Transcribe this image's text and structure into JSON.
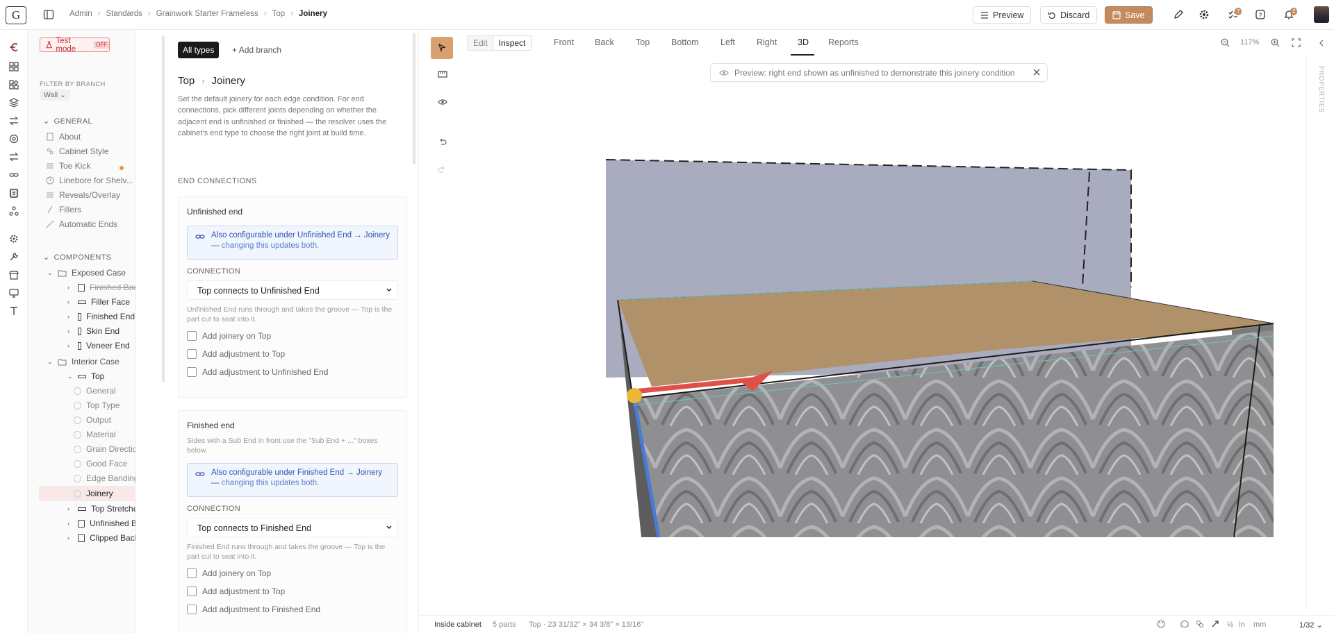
{
  "topbar": {
    "logo": "G",
    "breadcrumbs": [
      "Admin",
      "Standards",
      "Grainwork Starter Frameless",
      "Top",
      "Joinery"
    ],
    "preview_label": "Preview",
    "discard_label": "Discard",
    "save_label": "Save",
    "tasks_badge": "7",
    "notif_badge": "2"
  },
  "tree": {
    "test_mode_label": "Test mode",
    "test_mode_state": "OFF",
    "filter_label": "FILTER BY BRANCH",
    "branch_value": "Wall",
    "general_label": "GENERAL",
    "general_items": [
      "About",
      "Cabinet Style",
      "Toe Kick",
      "Linebore for Shelv...",
      "Reveals/Overlay",
      "Fillers",
      "Automatic Ends"
    ],
    "components_label": "COMPONENTS",
    "exposed_case": "Exposed Case",
    "exposed_items": [
      "Finished Back",
      "Filler Face",
      "Finished End",
      "Skin End",
      "Veneer End"
    ],
    "interior_case": "Interior Case",
    "top_label": "Top",
    "top_children": [
      "General",
      "Top Type",
      "Output",
      "Material",
      "Grain Direction",
      "Good Face",
      "Edge Banding",
      "Joinery"
    ],
    "after_items": [
      "Top Stretcher",
      "Unfinished Ba...",
      "Clipped Back"
    ]
  },
  "detail": {
    "all_types": "All types",
    "add_branch": "Add branch",
    "crumb_parent": "Top",
    "crumb_current": "Joinery",
    "description": "Set the default joinery for each edge condition. For end connections, pick different joints depending on whether the adjacent end is unfinished or finished — the resolver uses the cabinet's end type to choose the right joint at build time.",
    "end_connections": "END CONNECTIONS",
    "unfinished": {
      "title": "Unfinished end",
      "info_main": "Also configurable under Unfinished End → Joinery —",
      "info_link": "changing this updates both.",
      "connection_label": "CONNECTION",
      "connection_value": "Top connects to Unfinished End",
      "hint": "Unfinished End runs through and takes the groove — Top is the part cut to seat into it.",
      "checks": [
        "Add joinery on Top",
        "Add adjustment to Top",
        "Add adjustment to Unfinished End"
      ]
    },
    "finished": {
      "title": "Finished end",
      "subtitle": "Sides with a Sub End in front use the \"Sub End + ...\" boxes below.",
      "info_main": "Also configurable under Finished End → Joinery —",
      "info_link": "changing this updates both.",
      "connection_label": "CONNECTION",
      "connection_value": "Top connects to Finished End",
      "hint": "Finished End runs through and takes the groove — Top is the part cut to seat into it.",
      "checks": [
        "Add joinery on Top",
        "Add adjustment to Top",
        "Add adjustment to Finished End"
      ]
    }
  },
  "viewer": {
    "mode_edit": "Edit",
    "mode_inspect": "Inspect",
    "tabs": [
      "Front",
      "Back",
      "Top",
      "Bottom",
      "Left",
      "Right",
      "3D",
      "Reports"
    ],
    "active_tab": "3D",
    "zoom": "117%",
    "banner": "Preview: right end shown as unfinished to demonstrate this joinery condition",
    "properties_label": "PROPERTIES",
    "colors": {
      "accent": "#c48a5c",
      "top_panel": "#b0916a",
      "back_panel": "#a9acbe",
      "edge_red": "#e0504a",
      "edge_blue": "#4a7ad8",
      "marker": "#e9b93a"
    }
  },
  "status": {
    "location": "Inside cabinet",
    "parts": "5 parts",
    "part_info": "Top · 23 31/32\" × 34 3/8\" × 13/16\"",
    "unit_in": "in",
    "unit_mm": "mm",
    "precision": "1/32"
  }
}
